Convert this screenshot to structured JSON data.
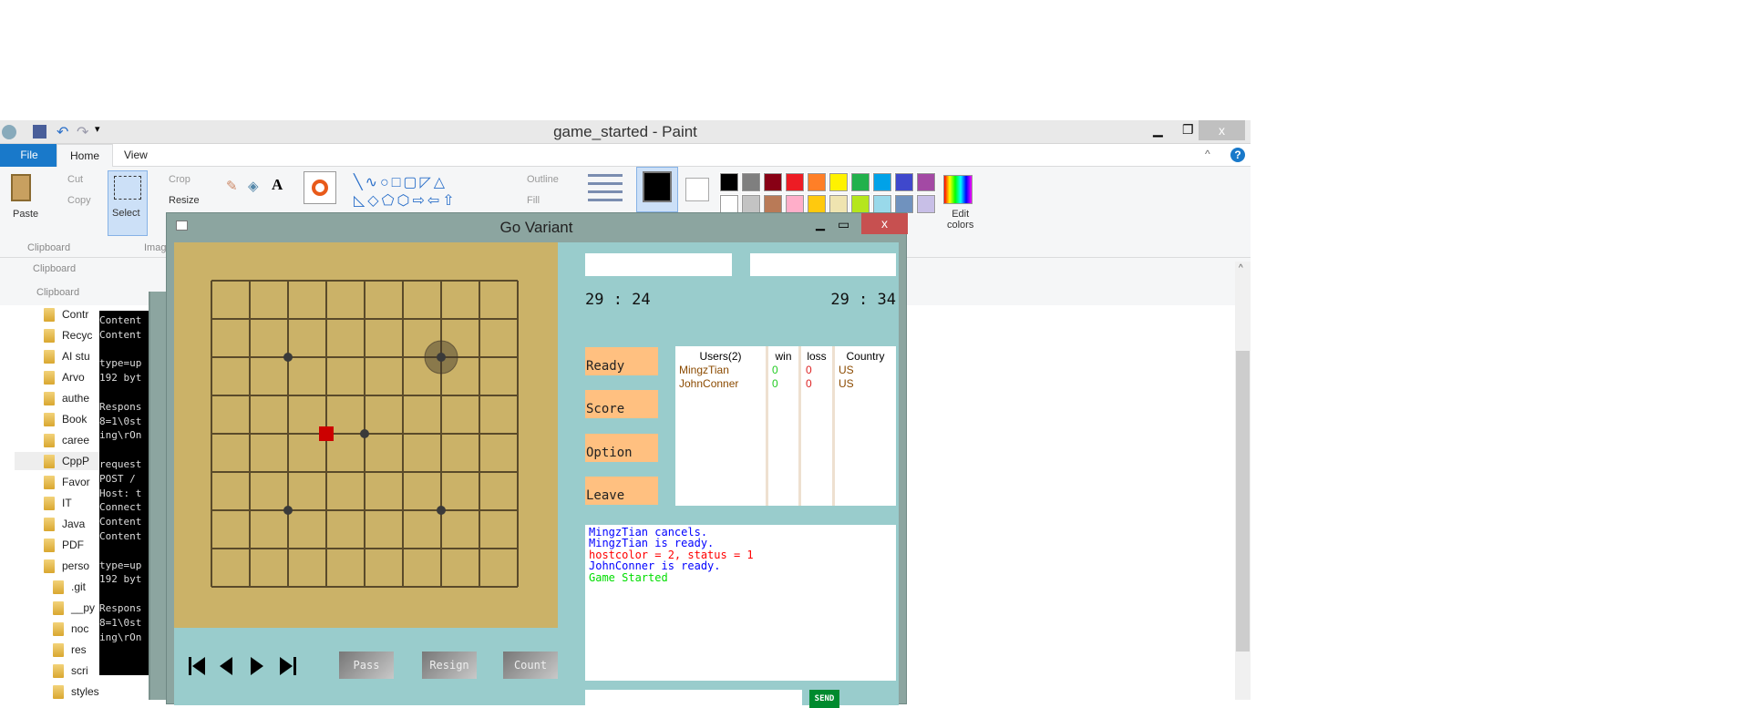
{
  "paint": {
    "title": "game_started - Paint",
    "tabs": [
      "File",
      "Home",
      "View"
    ],
    "clipboard": {
      "paste": "Paste",
      "cut": "Cut",
      "copy": "Copy",
      "group": "Clipboard"
    },
    "image": {
      "select": "Select",
      "crop": "Crop",
      "resize": "Resize",
      "group": "Imag"
    },
    "shapes": {
      "outline": "Outline",
      "fill": "Fill"
    },
    "edit_colors": [
      "Edit",
      "colors"
    ],
    "palette_row1": [
      "#000000",
      "#7f7f7f",
      "#880015",
      "#ed1c24",
      "#ff7f27",
      "#fff200",
      "#22b14c",
      "#00a2e8",
      "#3f48cc",
      "#a349a4"
    ],
    "palette_row2": [
      "#ffffff",
      "#c3c3c3",
      "#b97a57",
      "#ffaec9",
      "#ffc90e",
      "#efe4b0",
      "#b5e61d",
      "#99d9ea",
      "#7092be",
      "#c8bfe7"
    ],
    "primary_color": "#000000",
    "secondary_color": "#ffffff",
    "pane_labels": [
      "Clipboard",
      "Clipboard"
    ]
  },
  "tree": [
    "Contr",
    "Recyc",
    "AI stu",
    "Arvo",
    "authe",
    "Book",
    "caree",
    "CppP",
    "Favor",
    "IT",
    "Java",
    "PDF",
    "perso",
    ".git",
    "__py",
    "noc",
    "res",
    "scri",
    "styles"
  ],
  "terminal": [
    "Content",
    "Content",
    "",
    "type=up",
    "192 byt",
    "",
    "Respons",
    "8=1\\0st",
    "ing\\rOn",
    "",
    "request",
    "POST /",
    "Host: t",
    "Connect",
    "Content",
    "Content",
    "",
    "type=up",
    "192 byt",
    "",
    "Respons",
    "8=1\\0st",
    "ing\\rOn"
  ],
  "go": {
    "title": "Go Variant",
    "player1_name": "",
    "player2_name": "",
    "timer1": "29 : 24",
    "timer2": "29 : 34",
    "buttons": [
      "Ready",
      "Score",
      "Option",
      "Leave"
    ],
    "users_headers": [
      "Users(2)",
      "win",
      "loss",
      "Country"
    ],
    "users": [
      {
        "name": "MingzTian",
        "win": "0",
        "loss": "0",
        "country": "US"
      },
      {
        "name": "JohnConner",
        "win": "0",
        "loss": "0",
        "country": "US"
      }
    ],
    "log": [
      {
        "text": "MingzTian cancels.",
        "color": "#0000ff"
      },
      {
        "text": "MingzTian is ready.",
        "color": "#0000ff"
      },
      {
        "text": "hostcolor = 2, status = 1",
        "color": "#ff0000"
      },
      {
        "text": "JohnConner is ready.",
        "color": "#0000ff"
      },
      {
        "text": "Game Started",
        "color": "#00dd00"
      }
    ],
    "pass": "Pass",
    "resign": "Resign",
    "count": "Count",
    "chat_value": "",
    "send": "SEND",
    "board_size": 9,
    "star_points": [
      [
        2,
        2
      ],
      [
        6,
        2
      ],
      [
        4,
        4
      ],
      [
        2,
        6
      ],
      [
        6,
        6
      ]
    ],
    "last_move_marker": {
      "col": 3,
      "row": 4,
      "color": "#cc0000"
    },
    "hover_stone": {
      "col": 6,
      "row": 2
    }
  }
}
